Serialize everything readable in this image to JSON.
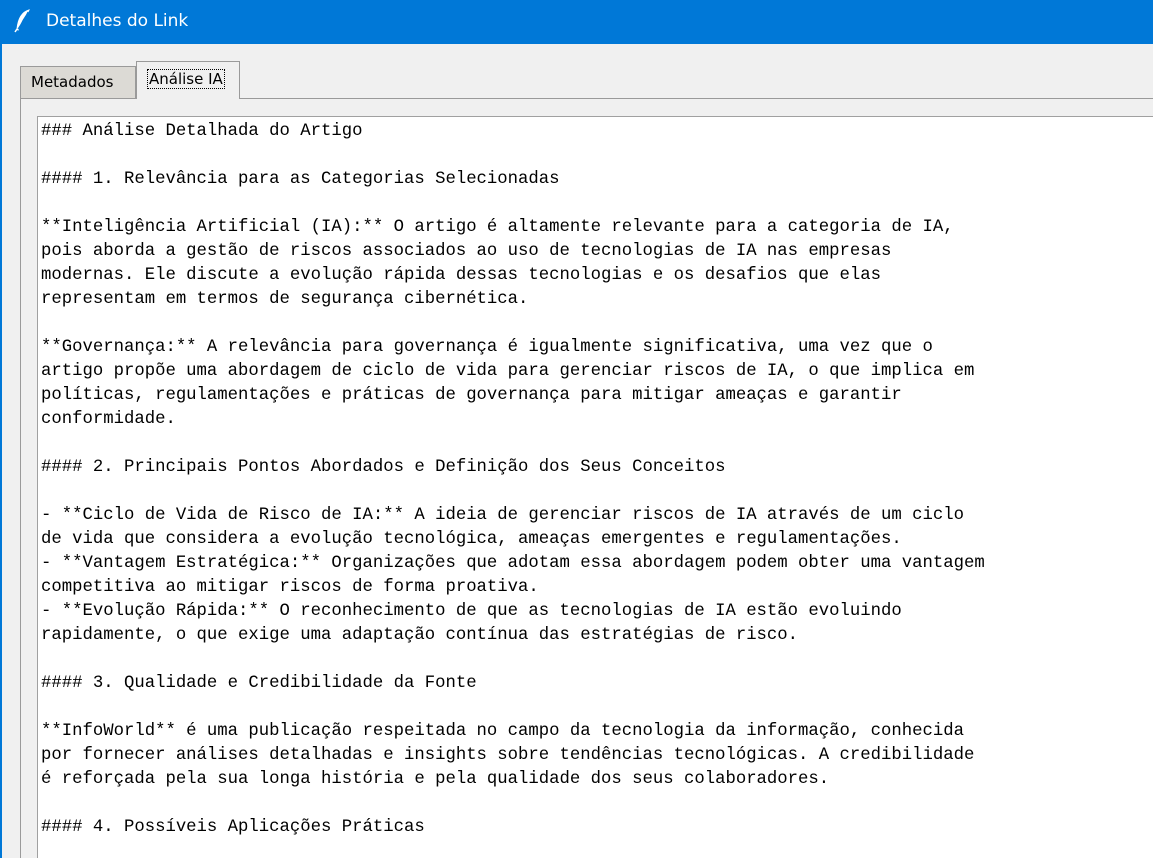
{
  "window": {
    "title": "Detalhes do Link",
    "icon": "feather-icon"
  },
  "tabs": [
    {
      "label": "Metadados",
      "selected": false
    },
    {
      "label": "Análise IA",
      "selected": true
    }
  ],
  "content": {
    "lines": [
      "### Análise Detalhada do Artigo",
      "",
      "#### 1. Relevância para as Categorias Selecionadas",
      "",
      "**Inteligência Artificial (IA):** O artigo é altamente relevante para a categoria de IA,",
      "pois aborda a gestão de riscos associados ao uso de tecnologias de IA nas empresas",
      "modernas. Ele discute a evolução rápida dessas tecnologias e os desafios que elas",
      "representam em termos de segurança cibernética.",
      "",
      "**Governança:** A relevância para governança é igualmente significativa, uma vez que o",
      "artigo propõe uma abordagem de ciclo de vida para gerenciar riscos de IA, o que implica em",
      "políticas, regulamentações e práticas de governança para mitigar ameaças e garantir",
      "conformidade.",
      "",
      "#### 2. Principais Pontos Abordados e Definição dos Seus Conceitos",
      "",
      "- **Ciclo de Vida de Risco de IA:** A ideia de gerenciar riscos de IA através de um ciclo",
      "de vida que considera a evolução tecnológica, ameaças emergentes e regulamentações.",
      "- **Vantagem Estratégica:** Organizações que adotam essa abordagem podem obter uma vantagem",
      "competitiva ao mitigar riscos de forma proativa.",
      "- **Evolução Rápida:** O reconhecimento de que as tecnologias de IA estão evoluindo",
      "rapidamente, o que exige uma adaptação contínua das estratégias de risco.",
      "",
      "#### 3. Qualidade e Credibilidade da Fonte",
      "",
      "**InfoWorld** é uma publicação respeitada no campo da tecnologia da informação, conhecida",
      "por fornecer análises detalhadas e insights sobre tendências tecnológicas. A credibilidade",
      "é reforçada pela sua longa história e pela qualidade dos seus colaboradores.",
      "",
      "#### 4. Possíveis Aplicações Práticas"
    ]
  },
  "colors": {
    "titlebar": "#0078d7",
    "background": "#f0f0f0",
    "text_area": "#ffffff"
  }
}
